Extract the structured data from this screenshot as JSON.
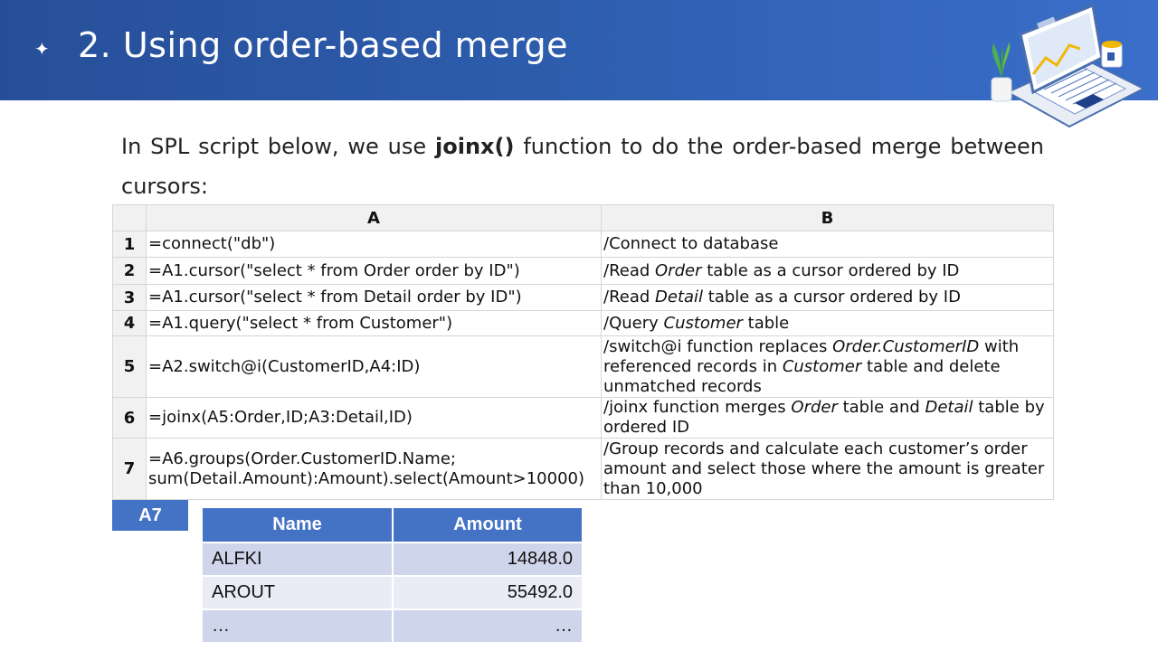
{
  "header": {
    "bullet": "✦",
    "title": "2. Using order-based merge"
  },
  "intro": {
    "text_before": "In SPL script below, we use ",
    "function_name": "joinx()",
    "text_after": " function to do the order-based merge between cursors:"
  },
  "grid": {
    "columns": [
      "A",
      "B"
    ],
    "rows": [
      {
        "num": "1",
        "a": "=connect(\"db\")",
        "b_parts": [
          "/Connect to database"
        ]
      },
      {
        "num": "2",
        "a": "=A1.cursor(\"select * from Order order by ID\")",
        "b_parts": [
          "/Read ",
          "Order",
          " table as a cursor ordered by ID"
        ]
      },
      {
        "num": "3",
        "a": "=A1.cursor(\"select * from Detail order by ID\")",
        "b_parts": [
          "/Read ",
          "Detail",
          " table as a cursor ordered by ID"
        ]
      },
      {
        "num": "4",
        "a": "=A1.query(\"select * from Customer\")",
        "b_parts": [
          "/Query ",
          "Customer",
          " table"
        ]
      },
      {
        "num": "5",
        "a": "=A2.switch@i(CustomerID,A4:ID)",
        "b_parts": [
          "/switch@i function replaces ",
          "Order.CustomerID",
          " with referenced records in ",
          "Customer",
          " table and delete unmatched records"
        ]
      },
      {
        "num": "6",
        "a": "=joinx(A5:Order,ID;A3:Detail,ID)",
        "b_parts": [
          "/joinx function merges ",
          "Order",
          " table and ",
          "Detail",
          " table by ordered ID"
        ]
      },
      {
        "num": "7",
        "a": "=A6.groups(Order.CustomerID.Name; sum(Detail.Amount):Amount).select(Amount>10000)",
        "b_parts": [
          "/Group records and calculate each customer’s order amount and select those where the amount is greater than 10,000"
        ]
      }
    ]
  },
  "result": {
    "cell_label": "A7",
    "headers": [
      "Name",
      "Amount"
    ],
    "rows": [
      {
        "name": "ALFKI",
        "amount": "14848.0"
      },
      {
        "name": "AROUT",
        "amount": "55492.0"
      },
      {
        "name": "…",
        "amount": "…"
      }
    ]
  }
}
